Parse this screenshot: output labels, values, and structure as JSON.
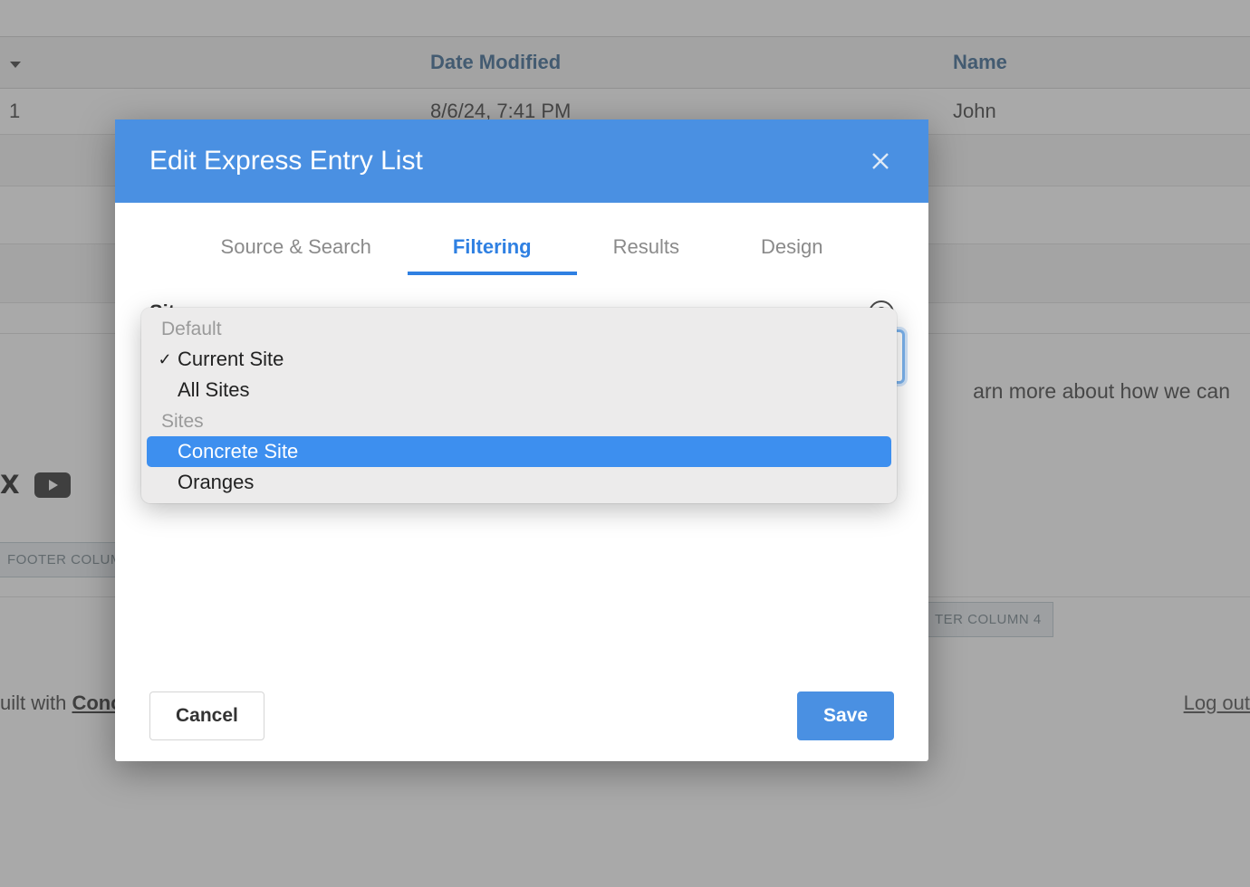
{
  "background": {
    "table": {
      "headers": {
        "date_modified": "Date Modified",
        "name": "Name"
      },
      "row": {
        "col1_tail": "1",
        "date_modified": "8/6/24, 7:41 PM",
        "name": "John"
      }
    },
    "footer": {
      "learn_more_tail": "arn more about how we can",
      "footer_column_left": "FOOTER COLUMN",
      "footer_column_4": "TER COLUMN 4",
      "built_with_prefix": "uilt with ",
      "built_with_link": "Concret",
      "logout": "Log out"
    }
  },
  "modal": {
    "title": "Edit Express Entry List",
    "tabs": {
      "source_search": "Source & Search",
      "filtering": "Filtering",
      "results": "Results",
      "design": "Design"
    },
    "body": {
      "site_label": "Site",
      "help_glyph": "?"
    },
    "footer": {
      "cancel": "Cancel",
      "save": "Save"
    }
  },
  "dropdown": {
    "groups": [
      {
        "label": "Default",
        "options": [
          {
            "label": "Current Site",
            "checked": true,
            "highlighted": false
          },
          {
            "label": "All Sites",
            "checked": false,
            "highlighted": false
          }
        ]
      },
      {
        "label": "Sites",
        "options": [
          {
            "label": "Concrete Site",
            "checked": false,
            "highlighted": true
          },
          {
            "label": "Oranges",
            "checked": false,
            "highlighted": false
          }
        ]
      }
    ]
  }
}
